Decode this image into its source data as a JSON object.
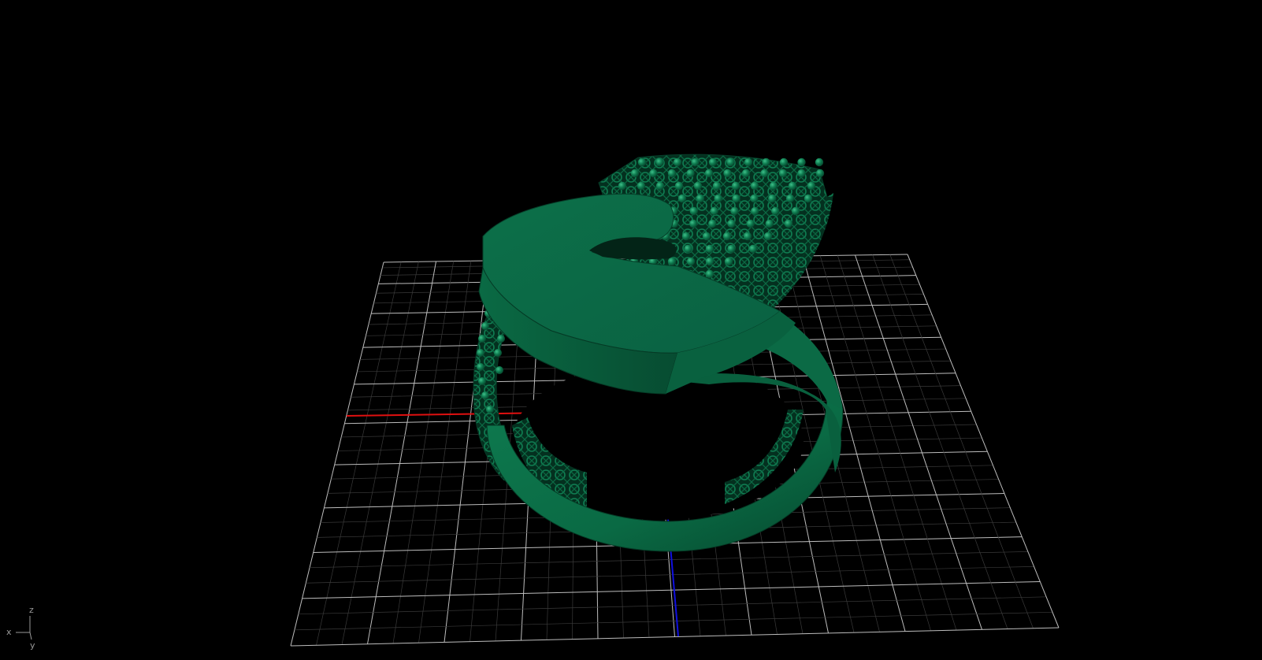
{
  "viewport": {
    "background": "#000000",
    "projection": "perspective",
    "grid": {
      "visible": true,
      "major_color": "#bdbdbd",
      "minor_color": "#3a3a3a"
    },
    "world_axes": {
      "x_color": "#e01010",
      "y_color": "#1010e0"
    },
    "model": {
      "object": "ring",
      "shading": "solid",
      "color": "#0b6b45",
      "highlight_color": "#1f9a67",
      "shadow_color": "#053a25"
    }
  },
  "axis_triad": {
    "x_label": "x",
    "y_label": "y",
    "z_label": "z",
    "color": "#9a9a9a"
  }
}
